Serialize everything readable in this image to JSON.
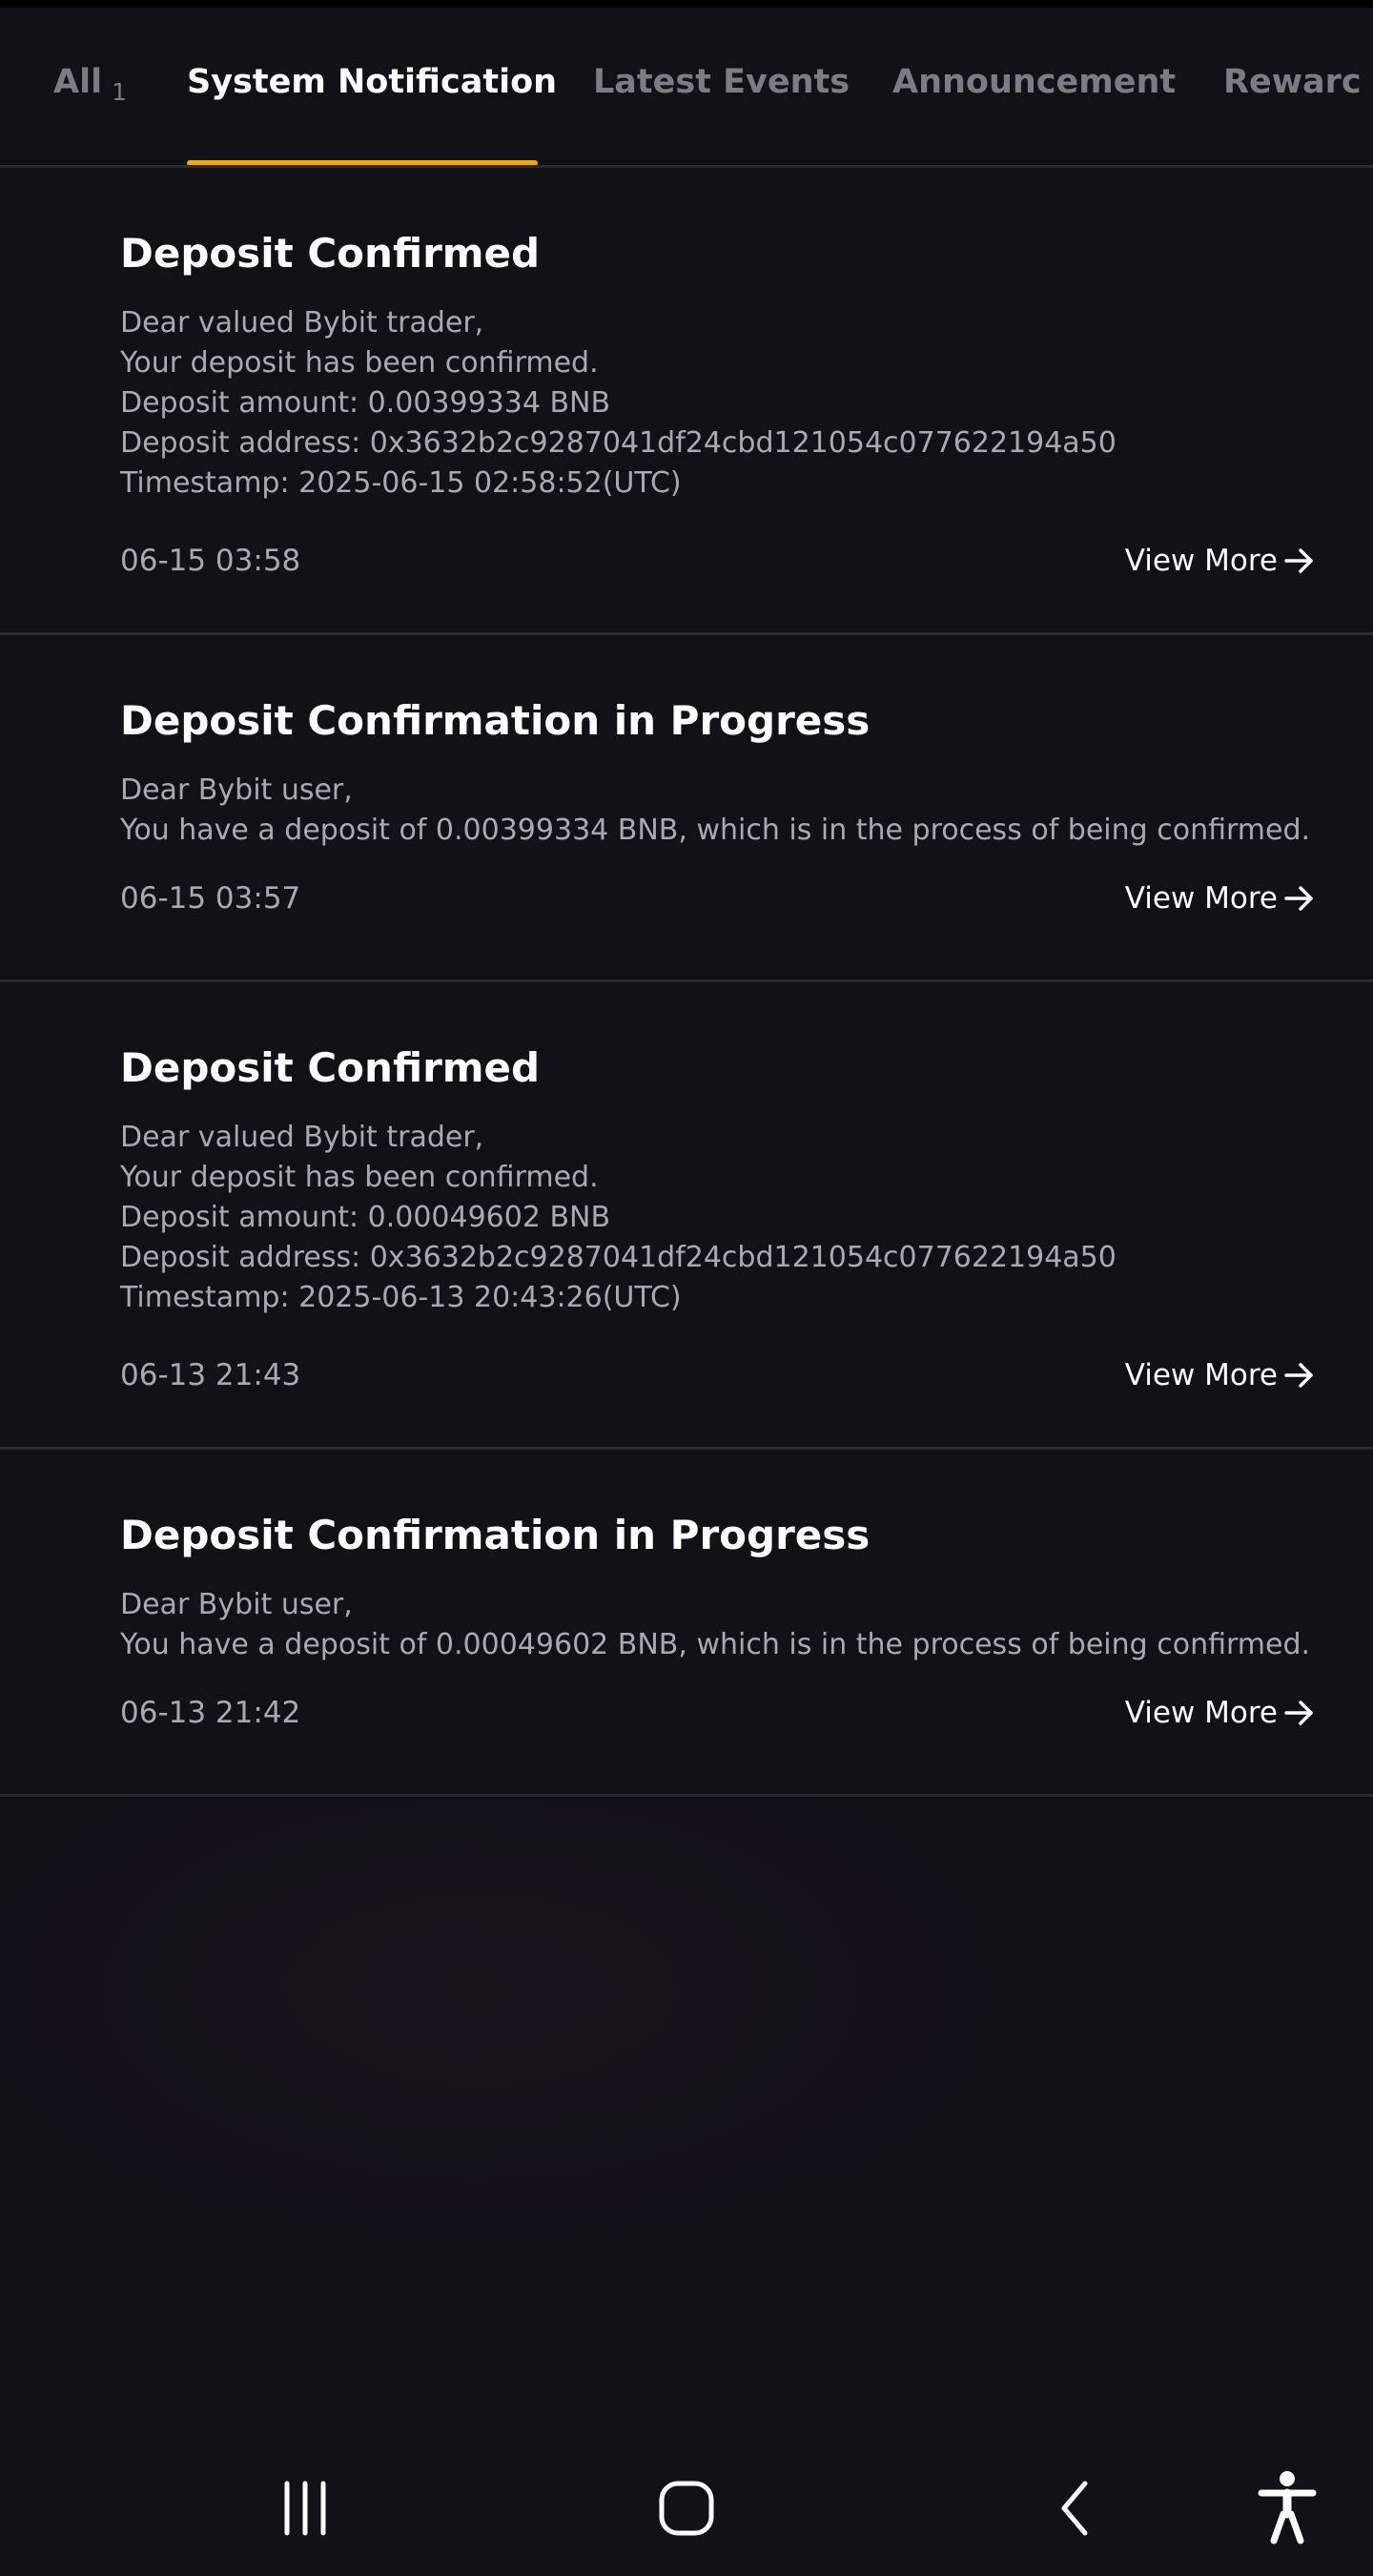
{
  "tabs": [
    {
      "label": "All",
      "count": "1",
      "active": false
    },
    {
      "label": "System Notification",
      "active": true
    },
    {
      "label": "Latest Events",
      "active": false
    },
    {
      "label": "Announcement",
      "active": false
    },
    {
      "label": "Rewarc",
      "active": false
    }
  ],
  "notifications": [
    {
      "title": "Deposit Confirmed",
      "lines": [
        "Dear valued Bybit trader,",
        "Your deposit has been confirmed.",
        "Deposit amount: 0.00399334 BNB",
        "Deposit address: 0x3632b2c9287041df24cbd121054c077622194a50",
        "Timestamp: 2025-06-15 02:58:52(UTC)"
      ],
      "date": "06-15 03:58",
      "action": "View More"
    },
    {
      "title": "Deposit Confirmation in Progress",
      "lines": [
        "Dear Bybit user,",
        "You have a deposit of 0.00399334 BNB, which is in the process of being confirmed."
      ],
      "date": "06-15 03:57",
      "action": "View More"
    },
    {
      "title": "Deposit Confirmed",
      "lines": [
        "Dear valued Bybit trader,",
        "Your deposit has been confirmed.",
        "Deposit amount: 0.00049602 BNB",
        "Deposit address: 0x3632b2c9287041df24cbd121054c077622194a50",
        "Timestamp: 2025-06-13 20:43:26(UTC)"
      ],
      "date": "06-13 21:43",
      "action": "View More"
    },
    {
      "title": "Deposit Confirmation in Progress",
      "lines": [
        "Dear Bybit user,",
        "You have a deposit of 0.00049602 BNB, which is in the process of being confirmed."
      ],
      "date": "06-13 21:42",
      "action": "View More"
    }
  ],
  "icons": {
    "view_more": "arrow-right-icon",
    "nav_recents": "recent-apps-icon",
    "nav_home": "home-icon",
    "nav_back": "back-icon",
    "nav_accessibility": "accessibility-icon"
  },
  "colors": {
    "background": "#111116",
    "accent": "#f7a600",
    "divider": "#2a2a30",
    "muted_text": "#a9a9b0",
    "inactive_tab": "#7c7c84"
  }
}
